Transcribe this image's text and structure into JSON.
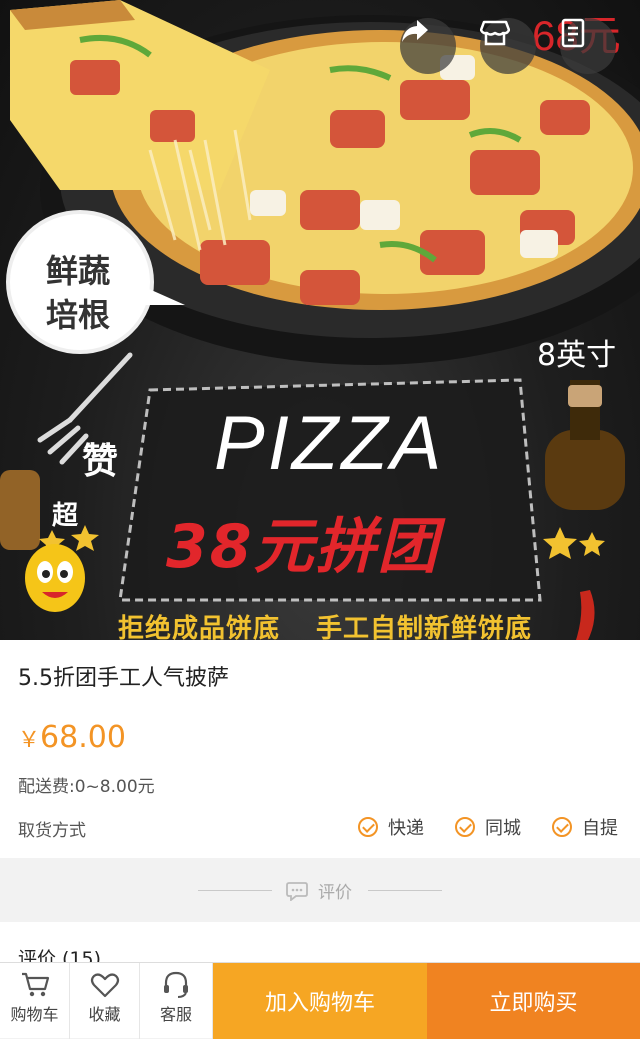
{
  "hero": {
    "price_tag": "68元",
    "bubble_line1": "鲜蔬",
    "bubble_line2": "培根",
    "size": "8英寸",
    "word_zan": "赞",
    "word_chao": "超",
    "pizza_word": "PIZZA",
    "group_price": "38元拼团",
    "slogan_left": "拒绝成品饼底",
    "slogan_right": "手工自制新鲜饼底",
    "buttons": [
      "share-icon",
      "shop-icon",
      "document-icon"
    ]
  },
  "product": {
    "title": "5.5折团手工人气披萨",
    "currency": "￥",
    "price": "68.00",
    "shipping": "配送费:0~8.00元",
    "pickup_label": "取货方式",
    "pickup_options": [
      "快递",
      "同城",
      "自提"
    ]
  },
  "reviews": {
    "divider_label": "评价",
    "heading": "评价 (15)"
  },
  "bottom_bar": {
    "cart": "购物车",
    "favorite": "收藏",
    "service": "客服",
    "add_to_cart": "加入购物车",
    "buy_now": "立即购买"
  },
  "colors": {
    "price": "#f39425",
    "add_to_cart_bg": "#f6a623",
    "buy_now_bg": "#f08321",
    "group_price_red": "#e2262b",
    "slogan_yellow": "#f2c230"
  }
}
